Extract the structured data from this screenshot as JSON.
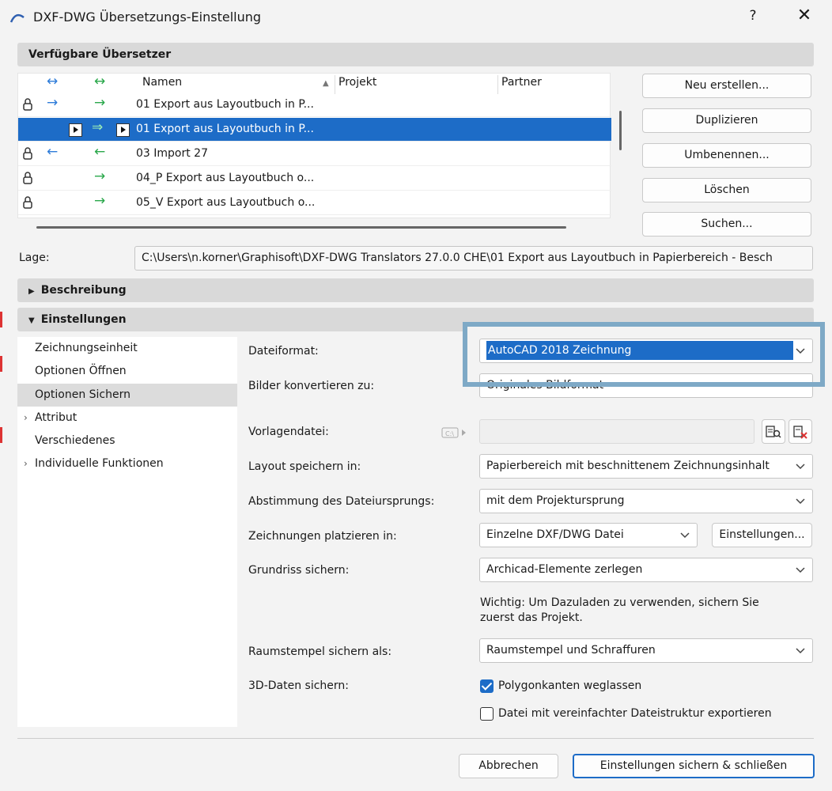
{
  "window": {
    "title": "DXF-DWG Übersetzungs-Einstellung",
    "help_label": "?",
    "close_label": "✕"
  },
  "translators": {
    "header": "Verfügbare Übersetzer",
    "columns": {
      "name": "Namen",
      "project": "Projekt",
      "partner": "Partner"
    },
    "rows": [
      {
        "name": "01 Export aus Layoutbuch in P..."
      },
      {
        "name": "01 Export aus Layoutbuch in P..."
      },
      {
        "name": "03 Import 27"
      },
      {
        "name": "04_P Export aus Layoutbuch o..."
      },
      {
        "name": "05_V Export aus Layoutbuch o..."
      }
    ],
    "buttons": {
      "new": "Neu erstellen...",
      "duplicate": "Duplizieren",
      "rename": "Umbenennen...",
      "delete": "Löschen",
      "search": "Suchen..."
    }
  },
  "location": {
    "label": "Lage:",
    "value": "C:\\Users\\n.korner\\Graphisoft\\DXF-DWG Translators 27.0.0 CHE\\01 Export aus Layoutbuch in Papierbereich - Besch"
  },
  "description_header": "Beschreibung",
  "settings_header": "Einstellungen",
  "nav": {
    "items": [
      {
        "label": "Zeichnungseinheit"
      },
      {
        "label": "Optionen Öffnen"
      },
      {
        "label": "Optionen Sichern"
      },
      {
        "label": "Attribut"
      },
      {
        "label": "Verschiedenes"
      },
      {
        "label": "Individuelle Funktionen"
      }
    ]
  },
  "form": {
    "file_format": {
      "label": "Dateiformat:",
      "value": "AutoCAD 2018 Zeichnung"
    },
    "convert_images": {
      "label": "Bilder konvertieren zu:",
      "value": "Originales Bildformat"
    },
    "template": {
      "label": "Vorlagendatei:"
    },
    "layout_save": {
      "label": "Layout speichern in:",
      "value": "Papierbereich mit beschnittenem Zeichnungsinhalt"
    },
    "origin": {
      "label": "Abstimmung des Dateiursprungs:",
      "value": "mit dem Projektursprung"
    },
    "place_drawings": {
      "label": "Zeichnungen platzieren in:",
      "value": "Einzelne DXF/DWG Datei",
      "button": "Einstellungen..."
    },
    "floorplan": {
      "label": "Grundriss sichern:",
      "value": "Archicad-Elemente zerlegen"
    },
    "note": "Wichtig: Um Dazuladen zu verwenden, sichern Sie zuerst das Projekt.",
    "zone_stamp": {
      "label": "Raumstempel sichern als:",
      "value": "Raumstempel und Schraffuren"
    },
    "data3d": {
      "label": "3D-Daten sichern:",
      "cb1": "Polygonkanten weglassen",
      "cb2": "Datei mit vereinfachter Dateistruktur exportieren"
    }
  },
  "footer": {
    "cancel": "Abbrechen",
    "save_close": "Einstellungen sichern & schließen"
  },
  "colors": {
    "selection": "#1d6cc7",
    "highlight_border": "#7ea9c6"
  }
}
